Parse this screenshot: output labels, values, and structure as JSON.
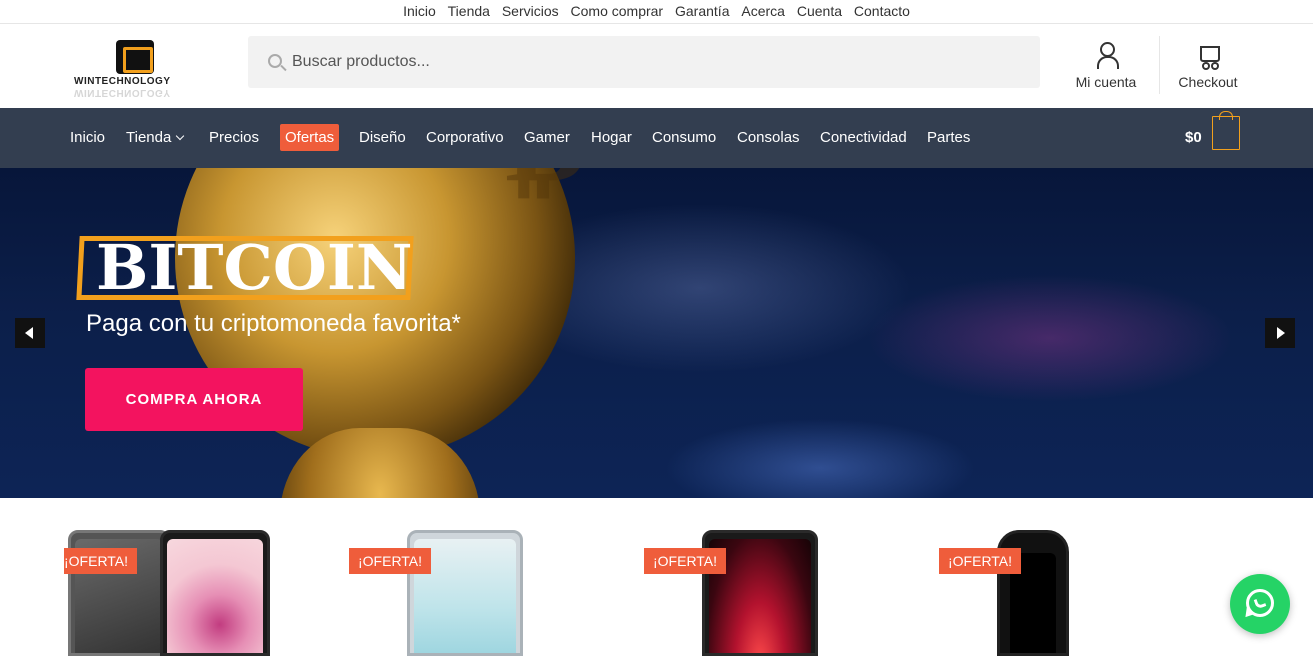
{
  "top_menu": [
    "Inicio",
    "Tienda",
    "Servicios",
    "Como comprar",
    "Garantía",
    "Acerca",
    "Cuenta",
    "Contacto"
  ],
  "logo": {
    "text": "WINTECHNOLOGY"
  },
  "search": {
    "placeholder": "Buscar productos..."
  },
  "header": {
    "account_label": "Mi cuenta",
    "checkout_label": "Checkout"
  },
  "nav": {
    "items": [
      "Inicio",
      "Tienda",
      "Precios",
      "Ofertas",
      "Diseño",
      "Corporativo",
      "Gamer",
      "Hogar",
      "Consumo",
      "Consolas",
      "Conectividad",
      "Partes"
    ],
    "cart_total": "$0"
  },
  "hero": {
    "title": "BITCOIN",
    "subtitle": "Paga con tu criptomoneda favorita*",
    "cta_label": "COMPRA AHORA"
  },
  "products": [
    {
      "badge": "¡OFERTA!"
    },
    {
      "badge": "¡OFERTA!"
    },
    {
      "badge": "¡OFERTA!"
    },
    {
      "badge": "¡OFERTA!"
    }
  ],
  "colors": {
    "nav_bg": "#333e50",
    "sale_accent": "#ef5d3b",
    "cta": "#f3135f",
    "logo_accent": "#f2a01d",
    "whatsapp": "#25d366"
  },
  "icons": [
    "search-icon",
    "user-icon",
    "cart-icon",
    "shopping-bag-icon",
    "chevron-down-icon",
    "arrow-left-icon",
    "arrow-right-icon",
    "whatsapp-icon"
  ]
}
